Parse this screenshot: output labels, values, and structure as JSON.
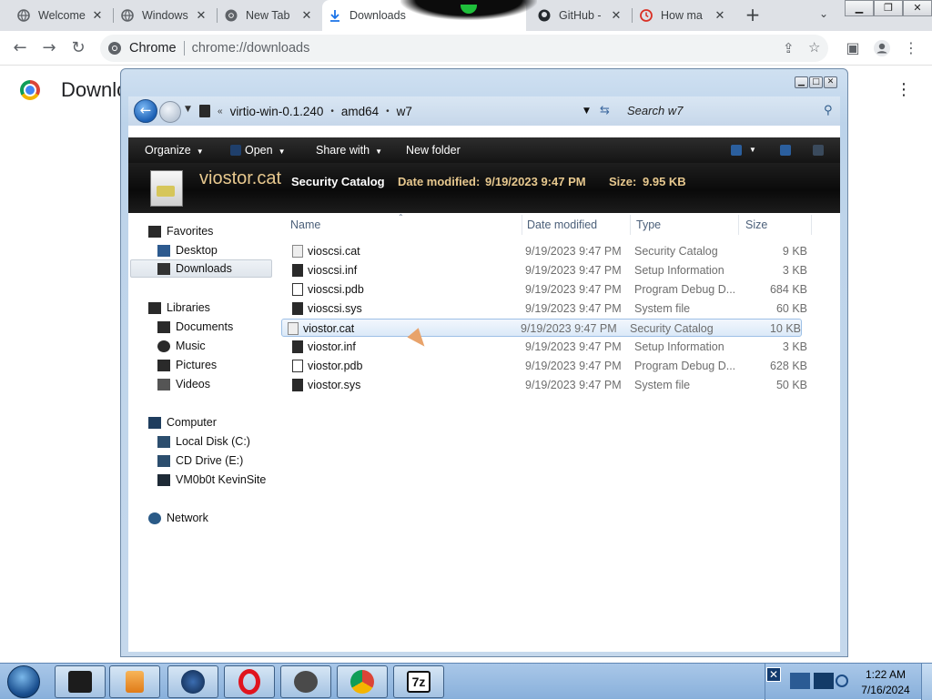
{
  "browser": {
    "tabs": [
      {
        "title": "Welcome",
        "icon": "globe-icon"
      },
      {
        "title": "Windows",
        "icon": "globe-icon"
      },
      {
        "title": "New Tab",
        "icon": "chrome-icon"
      },
      {
        "title": "Downloads",
        "icon": "download-icon"
      },
      {
        "title": "GitHub -",
        "icon": "github-icon"
      },
      {
        "title": "How ma",
        "icon": "clock-icon"
      }
    ],
    "new_tab_symbol": "+",
    "omnibox": {
      "site_label": "Chrome",
      "url": "chrome://downloads"
    },
    "page_title": "Downlo"
  },
  "explorer": {
    "breadcrumb": [
      "virtio-win-0.1.240",
      "amd64",
      "w7"
    ],
    "search_placeholder": "Search w7",
    "commands": {
      "organize": "Organize",
      "open": "Open",
      "share": "Share with",
      "new_folder": "New folder"
    },
    "details": {
      "name": "viostor.cat",
      "type": "Security Catalog",
      "modified_label": "Date modified:",
      "modified_value": "9/19/2023 9:47 PM",
      "size_label": "Size:",
      "size_value": "9.95 KB"
    },
    "nav": {
      "favorites": "Favorites",
      "desktop": "Desktop",
      "downloads": "Downloads",
      "libraries": "Libraries",
      "documents": "Documents",
      "music": "Music",
      "pictures": "Pictures",
      "videos": "Videos",
      "computer": "Computer",
      "local_disk": "Local Disk (C:)",
      "cd_drive": "CD Drive (E:)",
      "vm_share": "VM0b0t KevinSite",
      "network": "Network"
    },
    "columns": {
      "name": "Name",
      "date": "Date modified",
      "type": "Type",
      "size": "Size"
    },
    "files": [
      {
        "name": "vioscsi.cat",
        "date": "9/19/2023 9:47 PM",
        "type": "Security Catalog",
        "size": "9 KB"
      },
      {
        "name": "vioscsi.inf",
        "date": "9/19/2023 9:47 PM",
        "type": "Setup Information",
        "size": "3 KB"
      },
      {
        "name": "vioscsi.pdb",
        "date": "9/19/2023 9:47 PM",
        "type": "Program Debug D...",
        "size": "684 KB"
      },
      {
        "name": "vioscsi.sys",
        "date": "9/19/2023 9:47 PM",
        "type": "System file",
        "size": "60 KB"
      },
      {
        "name": "viostor.cat",
        "date": "9/19/2023 9:47 PM",
        "type": "Security Catalog",
        "size": "10 KB"
      },
      {
        "name": "viostor.inf",
        "date": "9/19/2023 9:47 PM",
        "type": "Setup Information",
        "size": "3 KB"
      },
      {
        "name": "viostor.pdb",
        "date": "9/19/2023 9:47 PM",
        "type": "Program Debug D...",
        "size": "628 KB"
      },
      {
        "name": "viostor.sys",
        "date": "9/19/2023 9:47 PM",
        "type": "System file",
        "size": "50 KB"
      }
    ]
  },
  "taskbar": {
    "time": "1:22 AM",
    "date": "7/16/2024",
    "pinned": [
      "explorer-icon",
      "media-player-icon",
      "globe-icon",
      "opera-icon",
      "gas-mask-icon",
      "chrome-icon",
      "7zip-icon"
    ],
    "seven_zip_label": "7z"
  },
  "colors": {
    "details_accent": "#e7c88e",
    "selection_border": "#9dc0e6",
    "taskbar": "#a9c7e8"
  }
}
